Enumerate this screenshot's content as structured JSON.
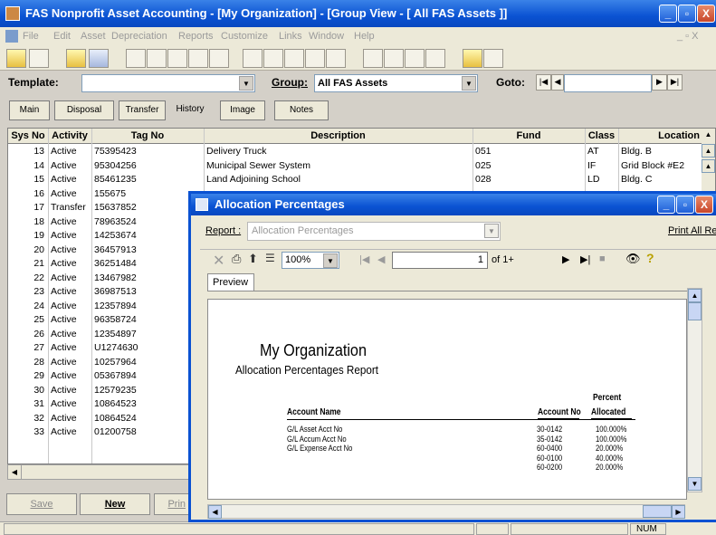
{
  "window": {
    "title": "FAS Nonprofit Asset Accounting - [My Organization] - [Group View - [ All FAS Assets ]]",
    "min": "_",
    "max": "▫",
    "close": "X"
  },
  "menu": [
    "File",
    "Edit",
    "Asset",
    "Depreciation",
    "Reports",
    "Customize",
    "Links",
    "Window",
    "Help"
  ],
  "menu_right": "_ ▫ X",
  "filters": {
    "template_label": "Template:",
    "template_value": "",
    "group_label": "Group:",
    "group_value": "All FAS Assets",
    "goto_label": "Goto:",
    "goto_value": ""
  },
  "tabs": [
    "Main",
    "Disposal",
    "Transfer",
    "History",
    "Image",
    "Notes"
  ],
  "grid": {
    "headers": [
      "Sys No",
      "Activity",
      "Tag No",
      "Description",
      "Fund",
      "Class",
      "Location"
    ],
    "rows": [
      [
        "13",
        "Active",
        "75395423",
        "Delivery Truck",
        "051",
        "AT",
        "Bldg. B"
      ],
      [
        "14",
        "Active",
        "95304256",
        "Municipal Sewer System",
        "025",
        "IF",
        "Grid Block #E2"
      ],
      [
        "15",
        "Active",
        "85461235",
        "Land Adjoining School",
        "028",
        "LD",
        "Bldg. C"
      ],
      [
        "16",
        "Active",
        "155675",
        "",
        "",
        "",
        ""
      ],
      [
        "17",
        "Transfer",
        "15637852",
        "",
        "",
        "",
        ""
      ],
      [
        "18",
        "Active",
        "78963524",
        "",
        "",
        "",
        ""
      ],
      [
        "19",
        "Active",
        "14253674",
        "",
        "",
        "",
        ""
      ],
      [
        "20",
        "Active",
        "36457913",
        "",
        "",
        "",
        ""
      ],
      [
        "21",
        "Active",
        "36251484",
        "",
        "",
        "",
        ""
      ],
      [
        "22",
        "Active",
        "13467982",
        "",
        "",
        "",
        ""
      ],
      [
        "23",
        "Active",
        "36987513",
        "",
        "",
        "",
        ""
      ],
      [
        "24",
        "Active",
        "12357894",
        "",
        "",
        "",
        ""
      ],
      [
        "25",
        "Active",
        "96358724",
        "",
        "",
        "",
        ""
      ],
      [
        "26",
        "Active",
        "12354897",
        "",
        "",
        "",
        ""
      ],
      [
        "27",
        "Active",
        "U1274630",
        "",
        "",
        "",
        ""
      ],
      [
        "28",
        "Active",
        "10257964",
        "",
        "",
        "",
        ""
      ],
      [
        "29",
        "Active",
        "05367894",
        "",
        "",
        "",
        ""
      ],
      [
        "30",
        "Active",
        "12579235",
        "",
        "",
        "",
        ""
      ],
      [
        "31",
        "Active",
        "10864523",
        "",
        "",
        "",
        ""
      ],
      [
        "32",
        "Active",
        "10864524",
        "",
        "",
        "",
        ""
      ],
      [
        "33",
        "Active",
        "01200758",
        "",
        "",
        "",
        ""
      ]
    ]
  },
  "buttons": {
    "save": "Save",
    "new": "New",
    "print": "Prin"
  },
  "status": {
    "num": "NUM"
  },
  "dialog": {
    "title": "Allocation Percentages",
    "report_label": "Report :",
    "report_value": "Allocation Percentages",
    "print_all": "Print All Re",
    "zoom": "100%",
    "page": "1",
    "of": "of 1+",
    "preview_tab": "Preview",
    "org": "My Organization",
    "report_title": "Allocation Percentages Report",
    "col_account_name": "Account Name",
    "col_account_no": "Account No",
    "col_percent": "Percent",
    "col_allocated": "Allocated",
    "lines": [
      {
        "name": "G/L Asset Acct No",
        "no": "30-0142",
        "pct": "100.000%"
      },
      {
        "name": "G/L Accum Acct No",
        "no": "35-0142",
        "pct": "100.000%"
      },
      {
        "name": "G/L Expense Acct No",
        "no": "60-0400",
        "pct": "20.000%"
      },
      {
        "name": "",
        "no": "60-0100",
        "pct": "40.000%"
      },
      {
        "name": "",
        "no": "60-0200",
        "pct": "20.000%"
      }
    ]
  }
}
